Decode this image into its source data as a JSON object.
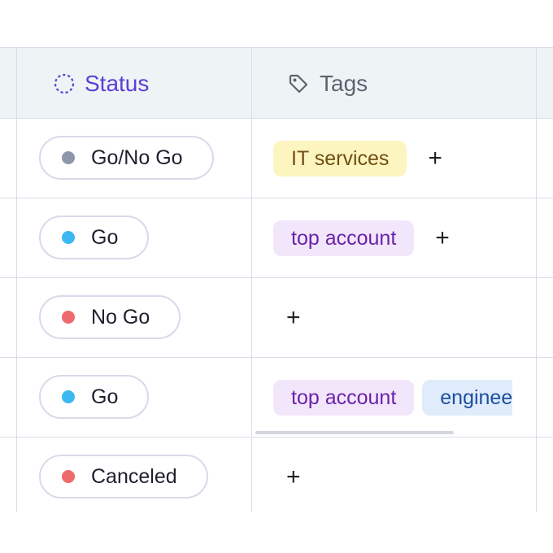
{
  "columns": {
    "status": {
      "label": "Status",
      "icon": "dashed-circle-icon"
    },
    "tags": {
      "label": "Tags",
      "icon": "tag-icon"
    }
  },
  "colors": {
    "status_header": "#5b3fd6",
    "dot_gray": "#8e97aa",
    "dot_blue": "#3bb8ef",
    "dot_red": "#ee6b6b",
    "tag_yellow_bg": "#fdf5c0",
    "tag_yellow_text": "#6f4e12",
    "tag_purple_bg": "#f2e6fb",
    "tag_purple_text": "#6a22a8",
    "tag_blue_bg": "#e0ecfb",
    "tag_blue_text": "#1c4fa0"
  },
  "rows": [
    {
      "status": "Go/No Go",
      "tags": [
        "IT services"
      ],
      "add": "+"
    },
    {
      "status": "Go",
      "tags": [
        "top account"
      ],
      "add": "+"
    },
    {
      "status": "No Go",
      "tags": [],
      "add": "+"
    },
    {
      "status": "Go",
      "tags": [
        "top account",
        "enginee"
      ],
      "add": ""
    },
    {
      "status": "Canceled",
      "tags": [],
      "add": "+"
    }
  ]
}
